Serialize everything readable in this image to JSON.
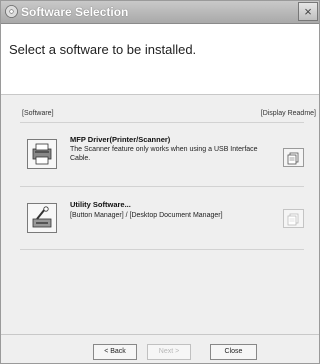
{
  "window": {
    "title": "Software Selection",
    "close_glyph": "×"
  },
  "header": {
    "prompt": "Select a software to be installed."
  },
  "list": {
    "col_software": "[Software]",
    "col_readme": "[Display Readme]",
    "items": [
      {
        "title": "MFP Driver(Printer/Scanner)",
        "desc_line1": "The Scanner feature only works when using a USB Interface",
        "desc_line2": "Cable.",
        "icon": "printer-scanner-icon",
        "readme_enabled": true
      },
      {
        "title": "Utility Software...",
        "desc_line1": "[Button Manager] / [Desktop Document Manager]",
        "icon": "utility-software-icon",
        "readme_enabled": false
      }
    ]
  },
  "footer": {
    "back": "< Back",
    "next": "Next >",
    "close": "Close"
  },
  "colors": {
    "titlebar": "#b5b5b5",
    "background": "#efefef"
  }
}
